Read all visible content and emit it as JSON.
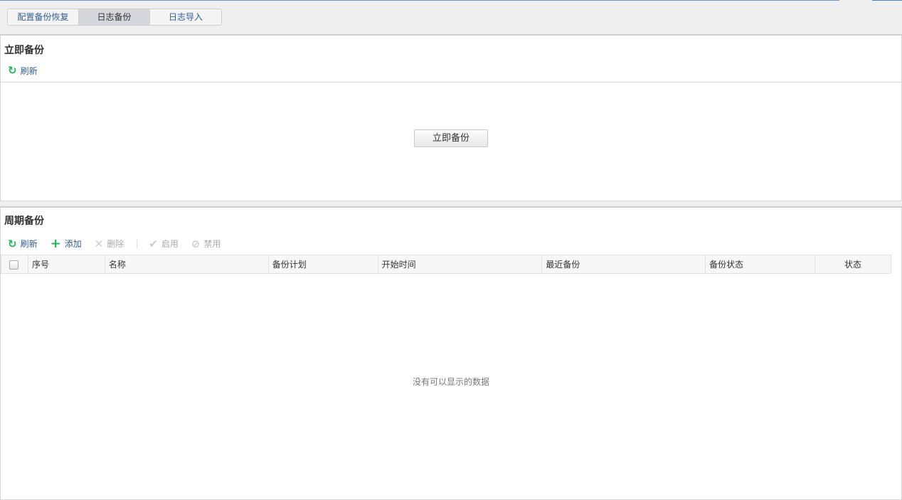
{
  "tabs": [
    {
      "label": "配置备份恢复"
    },
    {
      "label": "日志备份",
      "active": true
    },
    {
      "label": "日志导入"
    }
  ],
  "immediate": {
    "title": "立即备份",
    "refresh": "刷新",
    "backup_button": "立即备份"
  },
  "periodic": {
    "title": "周期备份",
    "toolbar": {
      "refresh": "刷新",
      "add": "添加",
      "delete": "删除",
      "enable": "启用",
      "disable": "禁用"
    },
    "columns": [
      "序号",
      "名称",
      "备份计划",
      "开始时间",
      "最近备份",
      "备份状态",
      "状态"
    ],
    "empty_text": "没有可以显示的数据"
  }
}
